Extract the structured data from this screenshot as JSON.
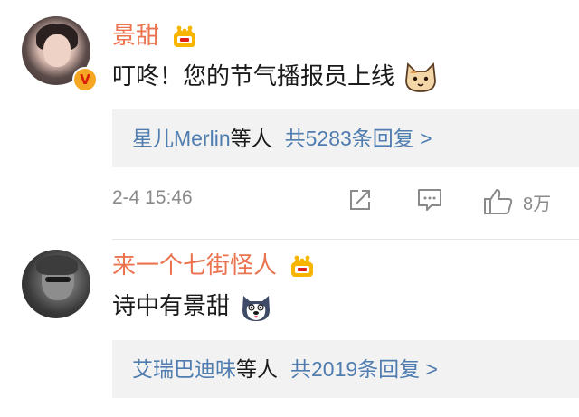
{
  "comments": [
    {
      "username": "景甜",
      "text": "叮咚！您的节气播报员上线",
      "reply": {
        "names": "星儿Merlin",
        "suffix": "等人",
        "count_text": "共5283条回复 >"
      },
      "time": "2-4 15:46",
      "likes": "8万"
    },
    {
      "username": "来一个七街怪人",
      "text": "诗中有景甜",
      "reply": {
        "names": "艾瑞巴迪味",
        "suffix": "等人",
        "count_text": "共2019条回复 >"
      }
    }
  ],
  "colors": {
    "username": "#eb7350",
    "link": "#507daf",
    "meta": "#8a8a8a",
    "reply_bg": "#f2f2f2"
  },
  "icons": [
    "crown-icon",
    "verified-icon",
    "cat-emoji",
    "dog-emoji",
    "share-icon",
    "comment-icon",
    "like-icon"
  ]
}
